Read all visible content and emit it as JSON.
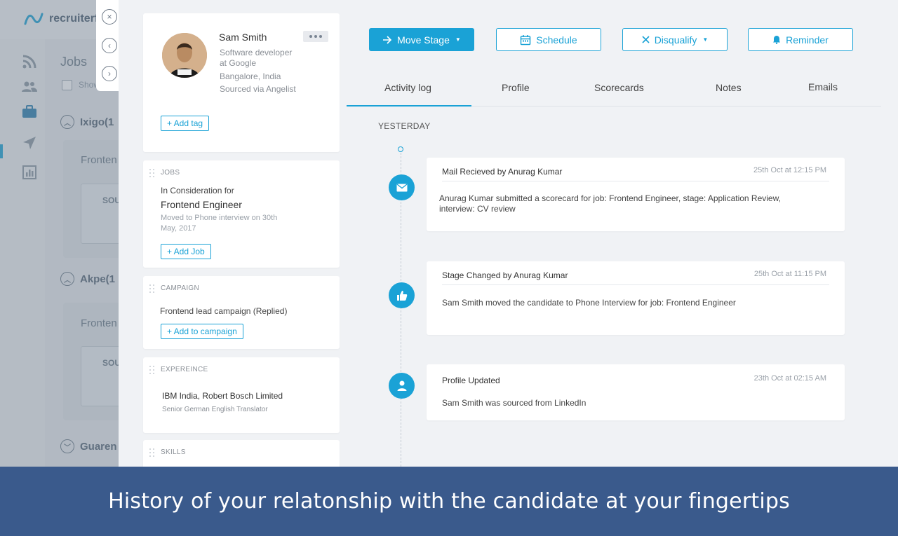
{
  "background": {
    "logo_text": "recruiterf",
    "page_title": "Jobs",
    "show_label": "Show",
    "groups": [
      {
        "label": "Ixigo(1"
      },
      {
        "label": "Akpe(1"
      },
      {
        "label": "Guaren"
      }
    ],
    "card_titles": [
      "Fronten",
      "Fronten"
    ],
    "subcard_labels": [
      "SOU",
      "SOU"
    ]
  },
  "nav": {
    "close": "×",
    "prev": "‹",
    "next": "›"
  },
  "candidate": {
    "name": "Sam Smith",
    "title_line1": "Software developer",
    "title_line2": "at Google",
    "location": "Bangalore, India",
    "source": "Sourced via Angelist",
    "add_tag": "+ Add tag"
  },
  "jobs": {
    "label": "JOBS",
    "consideration": "In Consideration for",
    "job_title": "Frontend Engineer",
    "moved_line1": "Moved to Phone interview on 30th",
    "moved_line2": "May, 2017",
    "add_job": "+ Add Job"
  },
  "campaign": {
    "label": "CAMPAIGN",
    "name": "Frontend lead campaign (Replied)",
    "add": "+ Add to campaign"
  },
  "experience": {
    "label": "EXPEREINCE",
    "companies": "IBM India, Robert Bosch Limited",
    "role": "Senior German English Translator"
  },
  "skills": {
    "label": "SKILLS"
  },
  "actions": {
    "move_stage": "Move Stage",
    "schedule": "Schedule",
    "disqualify": "Disqualify",
    "reminder": "Reminder"
  },
  "tabs": [
    {
      "label": "Activity log"
    },
    {
      "label": "Profile"
    },
    {
      "label": "Scorecards"
    },
    {
      "label": "Notes"
    },
    {
      "label": "Emails"
    }
  ],
  "timeline": {
    "day_label": "YESTERDAY",
    "events": [
      {
        "icon": "mail-icon",
        "title": "Mail Recieved by Anurag Kumar",
        "time": "25th Oct at 12:15 PM",
        "body": "Anurag Kumar submitted a scorecard for job: Frontend Engineer, stage: Application Review, interview: CV review"
      },
      {
        "icon": "thumbs-up-icon",
        "title": "Stage Changed by Anurag Kumar",
        "time": "25th Oct at 11:15 PM",
        "body": "Sam Smith moved the candidate to Phone Interview for job: Frontend Engineer"
      },
      {
        "icon": "user-icon",
        "title": "Profile Updated",
        "time": "23th Oct at 02:15 AM",
        "body": "Sam Smith was sourced from LinkedIn"
      }
    ]
  },
  "banner": {
    "text": "History of your relatonship with the candidate at your fingertips"
  },
  "colors": {
    "accent": "#1aa2d6",
    "banner": "#3a5a8c"
  }
}
